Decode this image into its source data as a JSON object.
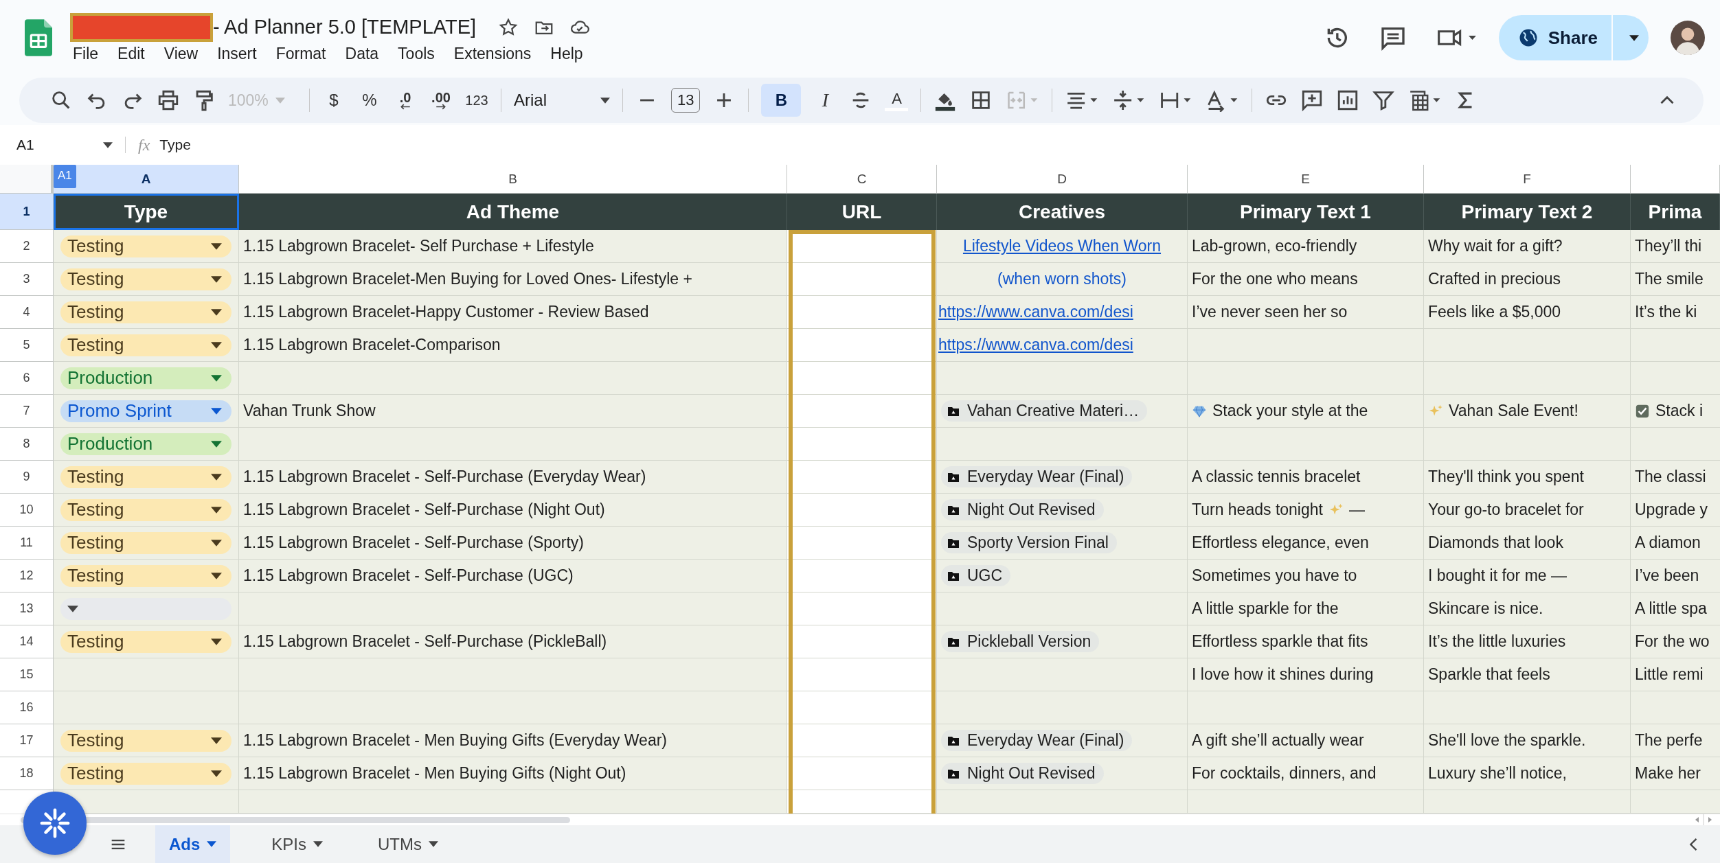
{
  "app": {
    "title": "- Ad Planner 5.0 [TEMPLATE]",
    "menu": [
      "File",
      "Edit",
      "View",
      "Insert",
      "Format",
      "Data",
      "Tools",
      "Extensions",
      "Help"
    ]
  },
  "share": {
    "label": "Share"
  },
  "toolbar": {
    "zoom": {
      "label": "100%",
      "disabled": true
    },
    "currency": "$",
    "percent": "%",
    "decrease_decimal": ".0",
    "increase_decimal": ".00",
    "number_format": "123",
    "font": "Arial",
    "font_size": "13",
    "bold": {
      "label": "B",
      "selected": true
    },
    "italic": "I",
    "text_color": "A",
    "merge": {
      "disabled": true
    }
  },
  "formula_bar": {
    "cell": "A1",
    "fx": "fx",
    "value": "Type"
  },
  "active_cell_tag": "A1",
  "columns": [
    {
      "letter": "A",
      "selected": true
    },
    {
      "letter": "B",
      "selected": false
    },
    {
      "letter": "C",
      "selected": false
    },
    {
      "letter": "D",
      "selected": false
    },
    {
      "letter": "E",
      "selected": false
    },
    {
      "letter": "F",
      "selected": false
    }
  ],
  "header_row": {
    "number": "1",
    "selected": true,
    "cells": [
      "Type",
      "Ad Theme",
      "URL",
      "Creatives",
      "Primary Text 1",
      "Primary Text 2",
      "Prima"
    ]
  },
  "rows": [
    {
      "number": "2",
      "type": {
        "kind": "testing",
        "label": "Testing",
        "color": "#fce8b2"
      },
      "theme": "1.15 Labgrown Bracelet- Self Purchase + Lifestyle",
      "creative": {
        "kind": "link",
        "text": "Lifestyle Videos When Worn"
      },
      "text1": "Lab-grown, eco-friendly",
      "text2": "Why wait for a gift?",
      "text3": "They’ll thi"
    },
    {
      "number": "3",
      "type": {
        "kind": "testing",
        "label": "Testing",
        "color": "#fce8b2"
      },
      "theme": "1.15 Labgrown Bracelet-Men Buying for Loved Ones- Lifestyle +",
      "creative": {
        "kind": "note",
        "text": "(when worn shots)"
      },
      "text1": "For the one who means",
      "text2": "Crafted in precious",
      "text3": "The smile"
    },
    {
      "number": "4",
      "type": {
        "kind": "testing",
        "label": "Testing",
        "color": "#fce8b2"
      },
      "theme": "1.15 Labgrown Bracelet-Happy Customer - Review Based",
      "creative": {
        "kind": "url",
        "text": "https://www.canva.com/desi"
      },
      "text1": "I’ve never seen her so",
      "text2": "Feels like a $5,000",
      "text3": "It’s the ki"
    },
    {
      "number": "5",
      "type": {
        "kind": "testing",
        "label": "Testing",
        "color": "#fce8b2"
      },
      "theme": "1.15 Labgrown Bracelet-Comparison",
      "creative": {
        "kind": "url",
        "text": "https://www.canva.com/desi"
      }
    },
    {
      "number": "6",
      "type": {
        "kind": "production",
        "label": "Production",
        "color": "#d4edbc"
      }
    },
    {
      "number": "7",
      "type": {
        "kind": "promo",
        "label": "Promo Sprint",
        "color": "#c6dcf5"
      },
      "theme": "Vahan Trunk Show",
      "creative": {
        "kind": "file",
        "text": "Vahan Creative Materi…"
      },
      "text1": {
        "kind": "gem",
        "text": "Stack your style at the"
      },
      "text2": {
        "kind": "sparkle",
        "text": "Vahan Sale Event!"
      },
      "text3": {
        "kind": "check",
        "text": "Stack i"
      }
    },
    {
      "number": "8",
      "type": {
        "kind": "production",
        "label": "Production",
        "color": "#d4edbc"
      }
    },
    {
      "number": "9",
      "type": {
        "kind": "testing",
        "label": "Testing",
        "color": "#fce8b2"
      },
      "theme": "1.15 Labgrown Bracelet - Self-Purchase (Everyday Wear)",
      "creative": {
        "kind": "file",
        "text": "Everyday Wear (Final)"
      },
      "text1": "A classic tennis bracelet",
      "text2": "They'll think you spent",
      "text3": "The classi"
    },
    {
      "number": "10",
      "type": {
        "kind": "testing",
        "label": "Testing",
        "color": "#fce8b2"
      },
      "theme": "1.15 Labgrown Bracelet - Self-Purchase (Night Out)",
      "creative": {
        "kind": "file",
        "text": "Night Out Revised"
      },
      "text1": {
        "text": "Turn heads tonight",
        "kind": "sparkle",
        "rest": "—"
      },
      "text2": "Your go-to bracelet for",
      "text3": "Upgrade y"
    },
    {
      "number": "11",
      "type": {
        "kind": "testing",
        "label": "Testing",
        "color": "#fce8b2"
      },
      "theme": "1.15 Labgrown Bracelet - Self-Purchase (Sporty)",
      "creative": {
        "kind": "file",
        "text": "Sporty Version Final"
      },
      "text1": "Effortless elegance, even",
      "text2": "Diamonds that look",
      "text3": "A diamon"
    },
    {
      "number": "12",
      "type": {
        "kind": "testing",
        "label": "Testing",
        "color": "#fce8b2"
      },
      "theme": "1.15 Labgrown Bracelet - Self-Purchase (UGC)",
      "creative": {
        "kind": "file",
        "text": "UGC"
      },
      "text1": "Sometimes you have to",
      "text2": "I bought it for me —",
      "text3": "I’ve been"
    },
    {
      "number": "13",
      "type": {
        "kind": "empty",
        "color": "#e8eaed"
      },
      "text1": "A little sparkle for the",
      "text2": "Skincare is nice.",
      "text3": "A little spa"
    },
    {
      "number": "14",
      "type": {
        "kind": "testing",
        "label": "Testing",
        "color": "#fce8b2"
      },
      "theme": "1.15 Labgrown Bracelet - Self-Purchase (PickleBall)",
      "creative": {
        "kind": "file",
        "text": "Pickleball Version"
      },
      "text1": "Effortless sparkle that fits",
      "text2": "It’s the little luxuries",
      "text3": "For the wo"
    },
    {
      "number": "15",
      "text1": "I love how it shines during",
      "text2": "Sparkle that feels",
      "text3": "Little remi"
    },
    {
      "number": "16"
    },
    {
      "number": "17",
      "type": {
        "kind": "testing",
        "label": "Testing",
        "color": "#fce8b2"
      },
      "theme": "1.15 Labgrown Bracelet - Men Buying Gifts (Everyday Wear)",
      "creative": {
        "kind": "file",
        "text": "Everyday Wear (Final)"
      },
      "text1": "A gift she’ll actually wear",
      "text2": "She'll love the sparkle.",
      "text3": "The perfe"
    },
    {
      "number": "18",
      "type": {
        "kind": "testing",
        "label": "Testing",
        "color": "#fce8b2"
      },
      "theme": "1.15 Labgrown Bracelet - Men Buying Gifts (Night Out)",
      "creative": {
        "kind": "file",
        "text": "Night Out Revised"
      },
      "text1": "For cocktails, dinners, and",
      "text2": "Luxury she’ll notice,",
      "text3": "Make her"
    }
  ],
  "sheet_tabs": [
    {
      "label": "Ads",
      "selected": true
    },
    {
      "label": "KPIs",
      "selected": false
    },
    {
      "label": "UTMs",
      "selected": false
    }
  ]
}
